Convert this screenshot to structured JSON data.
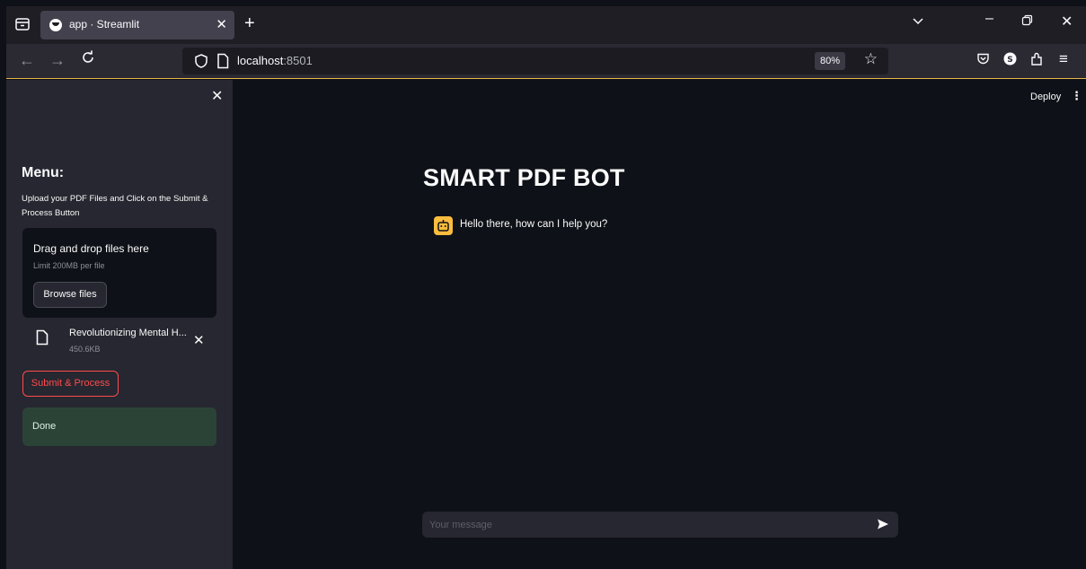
{
  "browser": {
    "tab_title": "app · Streamlit",
    "new_tab": "+",
    "url_host": "localhost",
    "url_port": ":8501",
    "zoom": "80%"
  },
  "sidebar": {
    "menu_title": "Menu:",
    "menu_desc": "Upload your PDF Files and Click on the Submit & Process Button",
    "dropzone_title": "Drag and drop files here",
    "dropzone_limit": "Limit 200MB per file",
    "browse_label": "Browse files",
    "file_name": "Revolutionizing Mental H...",
    "file_size": "450.6KB",
    "submit_label": "Submit & Process",
    "status_text": "Done"
  },
  "header": {
    "deploy_label": "Deploy"
  },
  "main": {
    "title": "SMART PDF BOT",
    "bot_message": "Hello there, how can I help you?",
    "input_placeholder": "Your message"
  },
  "colors": {
    "accent_red": "#ff4b4b",
    "success_bg": "#2b4336",
    "bot_avatar": "#fdbc3e"
  },
  "icons": [
    "tab-list-icon",
    "streamlit-favicon",
    "close-icon",
    "plus-icon",
    "chevron-down-icon",
    "minimize-icon",
    "restore-icon",
    "back-icon",
    "forward-icon",
    "reload-icon",
    "shield-icon",
    "page-icon",
    "star-icon",
    "pocket-icon",
    "account-icon",
    "extensions-icon",
    "menu-icon",
    "file-icon",
    "bot-icon",
    "send-icon",
    "kebab-icon"
  ]
}
